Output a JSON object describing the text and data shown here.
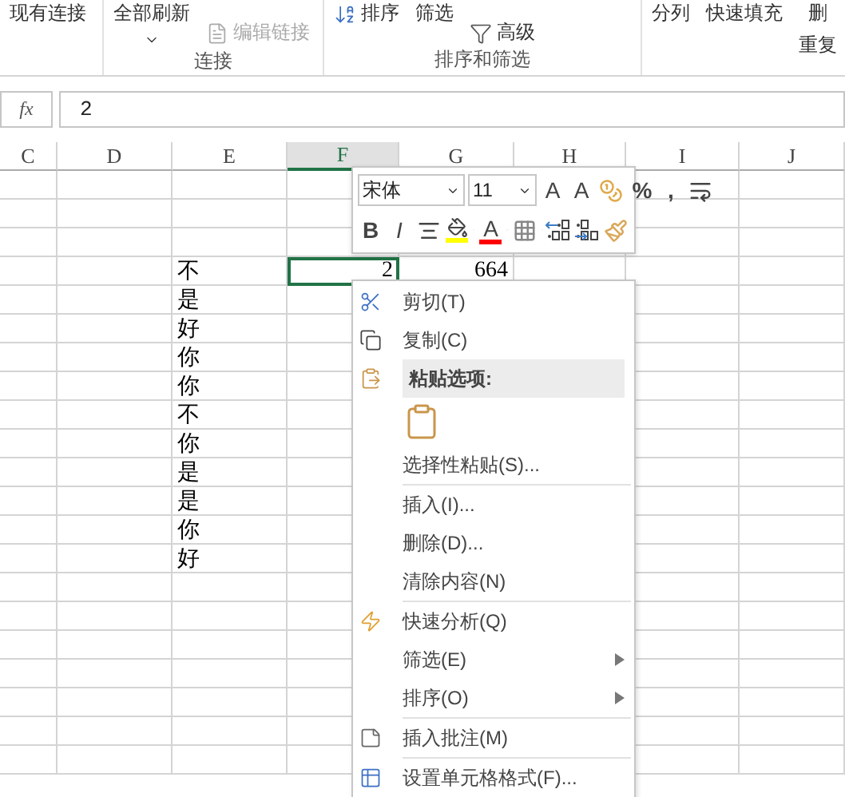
{
  "ribbon": {
    "groups": [
      {
        "items": [
          {
            "label": "现有连接",
            "kind": "large",
            "disabled": false
          }
        ]
      },
      {
        "label": "连接",
        "items": [
          {
            "label": "全部刷新",
            "kind": "dropdown",
            "disabled": false
          },
          {
            "label": "编辑链接",
            "kind": "link",
            "disabled": true
          }
        ]
      },
      {
        "label": "排序和筛选",
        "items": [
          {
            "label": "排序",
            "kind": "sort",
            "disabled": false
          },
          {
            "label": "筛选",
            "kind": "large",
            "disabled": false
          },
          {
            "label": "高级",
            "kind": "advanced",
            "disabled": false
          }
        ]
      },
      {
        "items": [
          {
            "label": "分列",
            "kind": "large",
            "disabled": false
          },
          {
            "label": "快速填充",
            "kind": "large",
            "disabled": false
          },
          {
            "label": "删",
            "second_line": "重复",
            "kind": "large",
            "disabled": false
          }
        ]
      }
    ]
  },
  "formula_bar": {
    "function_label": "fx",
    "value": "2"
  },
  "sheet": {
    "columns": [
      {
        "label": "C",
        "selected": false
      },
      {
        "label": "D",
        "selected": false
      },
      {
        "label": "E",
        "selected": false
      },
      {
        "label": "F",
        "selected": true
      },
      {
        "label": "G",
        "selected": false
      },
      {
        "label": "H",
        "selected": false
      },
      {
        "label": "I",
        "selected": false
      },
      {
        "label": "J",
        "selected": false
      }
    ],
    "rows": [
      {
        "active_cell": false
      },
      {
        "active_cell": false
      },
      {
        "active_cell": false
      },
      {
        "active_cell": true,
        "cells": {
          "E": "不",
          "F": "2",
          "G": "664"
        }
      },
      {
        "active_cell": false,
        "cells": {
          "E": "是"
        }
      },
      {
        "active_cell": false,
        "cells": {
          "E": "好"
        }
      },
      {
        "active_cell": false,
        "cells": {
          "E": "你"
        }
      },
      {
        "active_cell": false,
        "cells": {
          "E": "你"
        }
      },
      {
        "active_cell": false,
        "cells": {
          "E": "不"
        }
      },
      {
        "active_cell": false,
        "cells": {
          "E": "你"
        }
      },
      {
        "active_cell": false,
        "cells": {
          "E": "是"
        }
      },
      {
        "active_cell": false,
        "cells": {
          "E": "是"
        }
      },
      {
        "active_cell": false,
        "cells": {
          "E": "你"
        }
      },
      {
        "active_cell": false,
        "cells": {
          "E": "好"
        }
      },
      {
        "active_cell": false
      },
      {
        "active_cell": false
      },
      {
        "active_cell": false
      },
      {
        "active_cell": false
      },
      {
        "active_cell": false
      },
      {
        "active_cell": false
      },
      {
        "active_cell": false
      }
    ]
  },
  "mini_toolbar": {
    "font": "宋体",
    "size": "11",
    "row_1": [
      {
        "kind": "grow",
        "label": "A"
      },
      {
        "kind": "shrink",
        "label": "A"
      },
      {
        "kind": "accounting"
      },
      {
        "kind": "text",
        "label": "%"
      },
      {
        "kind": "text",
        "label": ","
      },
      {
        "kind": "wrap"
      }
    ],
    "row_2": [
      {
        "kind": "bold",
        "label": "B"
      },
      {
        "kind": "italic",
        "label": "I"
      },
      {
        "kind": "align"
      },
      {
        "kind": "fill",
        "color": "#ffff00"
      },
      {
        "kind": "font_color",
        "label": "A",
        "color": "#ff0000"
      },
      {
        "kind": "borders"
      },
      {
        "kind": "inc_decimal"
      },
      {
        "kind": "dec_decimal"
      },
      {
        "kind": "painter"
      }
    ]
  },
  "context_menu": [
    {
      "kind": "cut",
      "label": "剪切(T)"
    },
    {
      "kind": "copy",
      "label": "复制(C)"
    },
    {
      "kind": "paste_header",
      "label": "粘贴选项:"
    },
    {
      "kind": "paste_option"
    },
    {
      "kind": "plain",
      "label": "选择性粘贴(S)..."
    },
    {
      "kind": "plain",
      "label": "插入(I)...",
      "separator_before": true
    },
    {
      "kind": "plain",
      "label": "删除(D)..."
    },
    {
      "kind": "plain",
      "label": "清除内容(N)"
    },
    {
      "kind": "analysis",
      "label": "快速分析(Q)",
      "separator_before": true
    },
    {
      "kind": "submenu",
      "label": "筛选(E)"
    },
    {
      "kind": "submenu",
      "label": "排序(O)"
    },
    {
      "kind": "comment",
      "label": "插入批注(M)",
      "separator_before": true
    },
    {
      "kind": "format",
      "label": "设置单元格格式(F)...",
      "separator_before": true
    }
  ]
}
